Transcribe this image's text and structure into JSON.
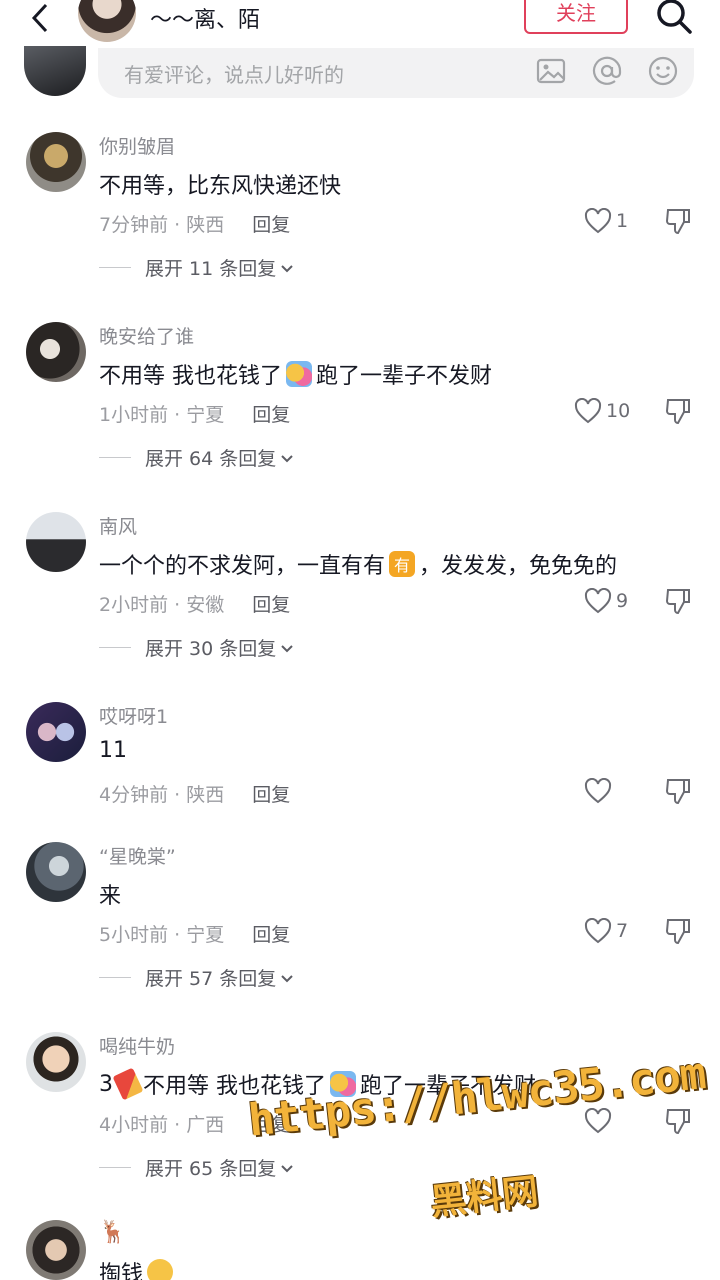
{
  "header": {
    "username": "～～离、陌",
    "follow_label": "关注"
  },
  "input": {
    "placeholder": "有爱评论，说点儿好听的"
  },
  "comments": [
    {
      "user": "你别皱眉",
      "text": "不用等，比东风快递还快",
      "time": "7分钟前 · 陕西",
      "reply": "回复",
      "likes": "1",
      "expand": "展开 11 条回复"
    },
    {
      "user": "晚安给了谁",
      "text_a": "不用等  我也花钱了",
      "text_b": "跑了一辈子不发财",
      "time": "1小时前 · 宁夏",
      "reply": "回复",
      "likes": "10",
      "expand": "展开 64 条回复"
    },
    {
      "user": "南风",
      "text_a": "一个个的不求发阿，一直有有",
      "emoji_label": "有",
      "text_b": "，发发发，免免免的",
      "time": "2小时前 · 安徽",
      "reply": "回复",
      "likes": "9",
      "expand": "展开 30 条回复"
    },
    {
      "user": "哎呀呀1",
      "text": "11",
      "time": "4分钟前 · 陕西",
      "reply": "回复",
      "likes": ""
    },
    {
      "user": "“星晚棠”",
      "text": "来",
      "time": "5小时前 · 宁夏",
      "reply": "回复",
      "likes": "7",
      "expand": "展开 57 条回复"
    },
    {
      "user": "喝纯牛奶",
      "text_a": "3",
      "text_b": "不用等  我也花钱了",
      "text_c": "跑了一辈子不发财",
      "time": "4小时前 · 广西",
      "reply": "回复",
      "likes": "",
      "expand": "展开 65 条回复"
    },
    {
      "user": "🦌",
      "text": "掏钱"
    }
  ],
  "watermark": {
    "url": "https://hlwc35.com",
    "label": "黑料网"
  }
}
